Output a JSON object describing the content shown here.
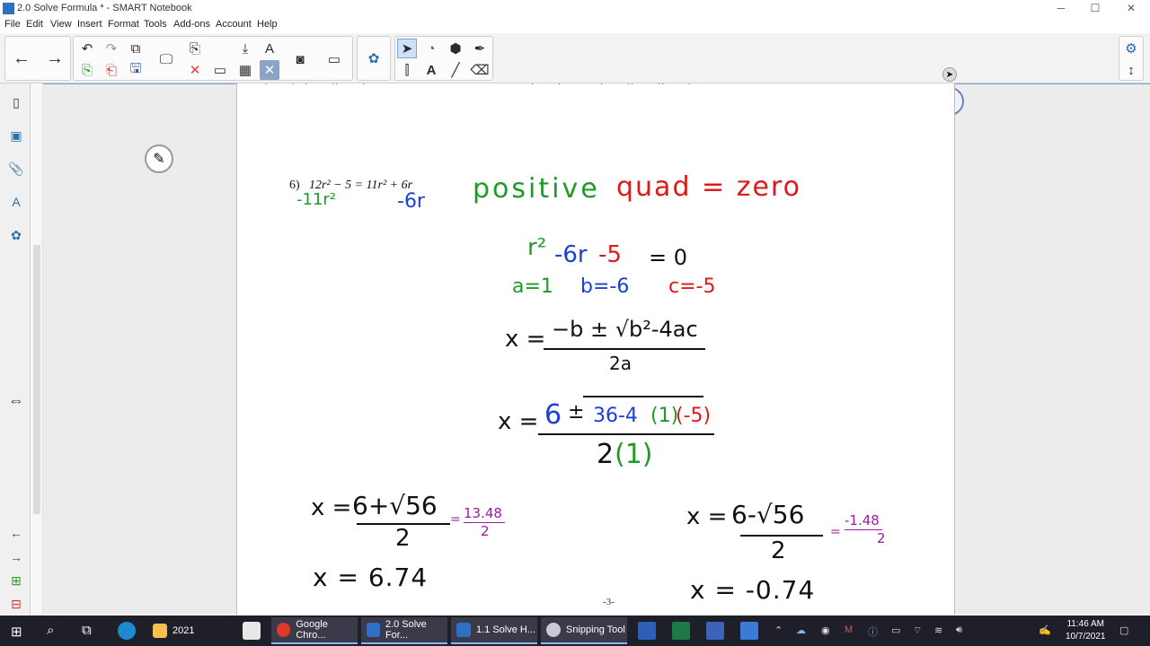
{
  "window": {
    "title": "2.0 Solve Formula * - SMART Notebook",
    "minimize": "─",
    "maximize": "☐",
    "close": "✕"
  },
  "menu": [
    "File",
    "Edit",
    "View",
    "Insert",
    "Format",
    "Tools",
    "Add-ons",
    "Account",
    "Help"
  ],
  "toolbar": {
    "icons": [
      "back-arrow-icon",
      "forward-arrow-icon",
      "undo-icon",
      "redo-icon",
      "add-page-icon",
      "paste-icon",
      "delete-page-icon",
      "save-icon",
      "display-icon",
      "clear-icon",
      "screen-shade-icon",
      "table-icon",
      "close-page-icon",
      "camera-icon",
      "record-icon",
      "addon-icon",
      "select-icon",
      "shapes-icon",
      "fill-icon",
      "pen-icon",
      "measure-icon",
      "text-icon",
      "line-icon",
      "eraser-icon",
      "settings-icon",
      "move-toolbar-icon"
    ]
  },
  "sidebar": {
    "icons": [
      "page-sorter-icon",
      "gallery-icon",
      "attachments-icon",
      "properties-icon",
      "addons-icon",
      "resize-arrow-icon",
      "prev-page-icon",
      "next-page-icon",
      "add-page-icon",
      "delete-page-icon"
    ]
  },
  "page": {
    "problem_number": "6)",
    "problem_text": "12r² − 5 = 11r² + 6r",
    "sub_left": "-11r²",
    "sub_right": "-6r",
    "note_positive": "positive",
    "note_zero": "quad = zero",
    "equation": {
      "r2": "r²",
      "minus6r": "-6r",
      "minus5": "-5",
      "eq0": "= 0"
    },
    "coefficients": {
      "a": "a=1",
      "b": "b=-6",
      "c": "c=-5"
    },
    "formula": {
      "lhs": "x =",
      "numerator": "−b ± √b²-4ac",
      "denominator": "2a"
    },
    "substituted": {
      "lhs": "x =",
      "six": "6",
      "pm": "±",
      "radicand_36": "36-4",
      "one": "(1)",
      "neg5": "(-5)",
      "denom_two": "2",
      "denom_one": "(1)"
    },
    "left_solution": {
      "expr_num": "6+√56",
      "expr_den": "2",
      "approx_num": "13.48",
      "approx_den": "2",
      "result": "x = 6.74",
      "lhs": "x ="
    },
    "right_solution": {
      "expr_num": "6-√56",
      "expr_den": "2",
      "approx_num": "-1.48",
      "approx_den": "2",
      "result": "x = -0.74",
      "lhs": "x ="
    },
    "page_number": "-3-",
    "eq_sign": "="
  },
  "taskbar": {
    "items": [
      {
        "label": "2021"
      },
      {
        "label": "Google Chro..."
      },
      {
        "label": "2.0 Solve For..."
      },
      {
        "label": "1.1 Solve H..."
      },
      {
        "label": "Snipping Tool"
      }
    ],
    "time": "11:46 AM",
    "date": "10/7/2021"
  },
  "colors": {
    "green": "#1f9a2a",
    "blue": "#1c3fd6",
    "red": "#e01818",
    "purple": "#9a1ea0",
    "black": "#111111"
  }
}
